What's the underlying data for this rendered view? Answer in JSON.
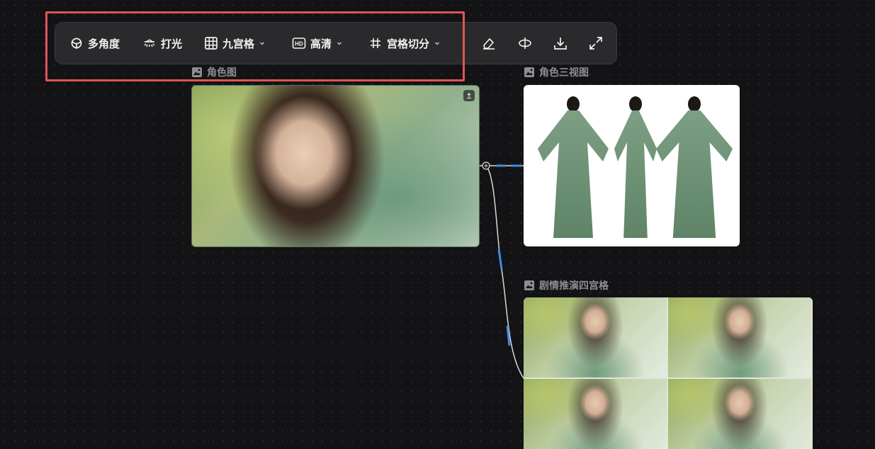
{
  "toolbar": {
    "items": [
      {
        "label": "多角度",
        "icon": "multi-angle-icon"
      },
      {
        "label": "打光",
        "icon": "lighting-icon"
      },
      {
        "label": "九宫格",
        "icon": "grid-icon",
        "dropdown": true
      },
      {
        "label": "高清",
        "icon": "hd-icon",
        "dropdown": true
      },
      {
        "label": "宫格切分",
        "icon": "hash-icon",
        "dropdown": true
      }
    ],
    "icon_buttons": [
      "eraser-icon",
      "flip-icon",
      "download-icon",
      "expand-icon"
    ],
    "hd_badge": "HD"
  },
  "nodes": {
    "main": {
      "label": "角色图"
    },
    "three_view": {
      "label": "角色三视图"
    },
    "four_grid": {
      "label": "剧情推演四宫格"
    }
  },
  "colors": {
    "highlight": "#e05555",
    "connector_accent": "#3b8fe0",
    "toolbar_bg": "#2a2a2d"
  }
}
